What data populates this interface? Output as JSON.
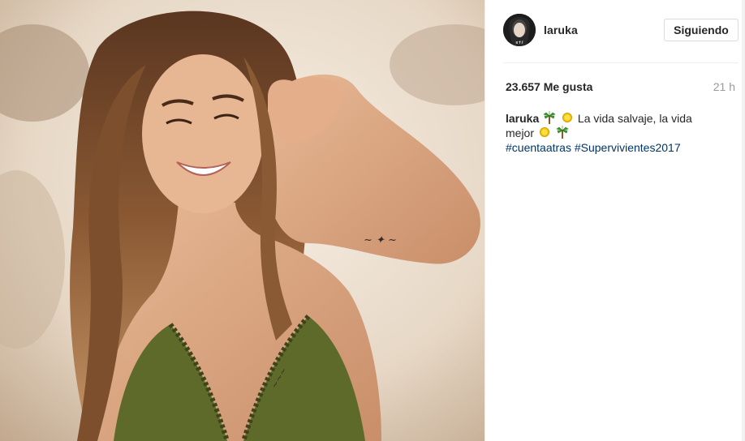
{
  "post": {
    "photo_alt": "",
    "username": "laruka",
    "follow_label": "Siguiendo",
    "likes": "23.657 Me gusta",
    "time": "21 h",
    "caption": {
      "user": "laruka",
      "text_a": "La vida salvaje, la vida",
      "text_b": "mejor",
      "emoji_a": [
        "palm-tree-icon",
        "sun-icon"
      ],
      "emoji_b": [
        "sun-icon",
        "palm-tree-icon"
      ],
      "hashtags": [
        "#cuentaatras",
        "#Supervivientes2017"
      ]
    }
  },
  "colors": {
    "link": "#003569",
    "text": "#262626",
    "muted": "#999999",
    "swimsuit": "#5e6a2a",
    "hair": "#7a4b2a"
  }
}
